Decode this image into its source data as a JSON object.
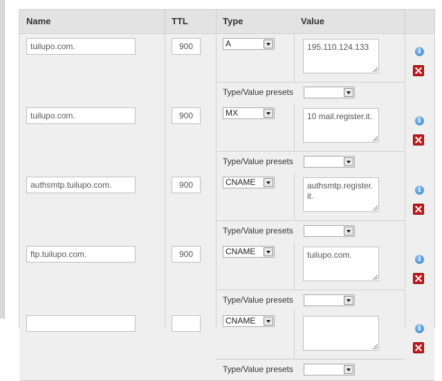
{
  "header": {
    "name": "Name",
    "ttl": "TTL",
    "type": "Type",
    "value": "Value"
  },
  "preset_label": "Type/Value presets",
  "records": [
    {
      "name": "tuilupo.com.",
      "ttl": "900",
      "type": "A",
      "value": "195.110.124.133",
      "preset": ""
    },
    {
      "name": "tuilupo.com.",
      "ttl": "900",
      "type": "MX",
      "value": "10 mail.register.it.",
      "preset": ""
    },
    {
      "name": "authsmtp.tuilupo.com.",
      "ttl": "900",
      "type": "CNAME",
      "value": "authsmtp.register.it.",
      "preset": ""
    },
    {
      "name": "ftp.tuilupo.com.",
      "ttl": "900",
      "type": "CNAME",
      "value": "tuilupo.com.",
      "preset": ""
    },
    {
      "name": "",
      "ttl": "",
      "type": "CNAME",
      "value": "",
      "preset": ""
    }
  ],
  "icons": {
    "info": "info-icon",
    "delete": "delete-icon"
  },
  "colors": {
    "header_bg": "#e3e3e3",
    "row_bg": "#efefef",
    "delete": "#c81a1a",
    "info": "#2f7fc5"
  }
}
